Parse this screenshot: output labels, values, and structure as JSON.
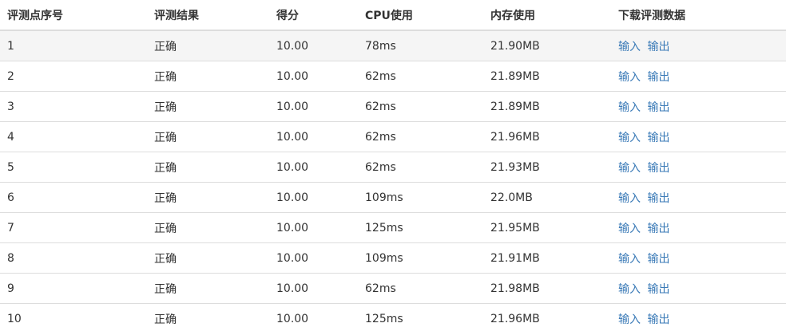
{
  "table": {
    "headers": [
      "评测点序号",
      "评测结果",
      "得分",
      "CPU使用",
      "内存使用",
      "下载评测数据"
    ],
    "rows": [
      {
        "index": "1",
        "result": "正确",
        "score": "10.00",
        "cpu": "78ms",
        "memory": "21.90MB",
        "input_label": "输入",
        "output_label": "输出"
      },
      {
        "index": "2",
        "result": "正确",
        "score": "10.00",
        "cpu": "62ms",
        "memory": "21.89MB",
        "input_label": "输入",
        "output_label": "输出"
      },
      {
        "index": "3",
        "result": "正确",
        "score": "10.00",
        "cpu": "62ms",
        "memory": "21.89MB",
        "input_label": "输入",
        "output_label": "输出"
      },
      {
        "index": "4",
        "result": "正确",
        "score": "10.00",
        "cpu": "62ms",
        "memory": "21.96MB",
        "input_label": "输入",
        "output_label": "输出"
      },
      {
        "index": "5",
        "result": "正确",
        "score": "10.00",
        "cpu": "62ms",
        "memory": "21.93MB",
        "input_label": "输入",
        "output_label": "输出"
      },
      {
        "index": "6",
        "result": "正确",
        "score": "10.00",
        "cpu": "109ms",
        "memory": "22.0MB",
        "input_label": "输入",
        "output_label": "输出"
      },
      {
        "index": "7",
        "result": "正确",
        "score": "10.00",
        "cpu": "125ms",
        "memory": "21.95MB",
        "input_label": "输入",
        "output_label": "输出"
      },
      {
        "index": "8",
        "result": "正确",
        "score": "10.00",
        "cpu": "109ms",
        "memory": "21.91MB",
        "input_label": "输入",
        "output_label": "输出"
      },
      {
        "index": "9",
        "result": "正确",
        "score": "10.00",
        "cpu": "62ms",
        "memory": "21.98MB",
        "input_label": "输入",
        "output_label": "输出"
      },
      {
        "index": "10",
        "result": "正确",
        "score": "10.00",
        "cpu": "125ms",
        "memory": "21.96MB",
        "input_label": "输入",
        "output_label": "输出"
      }
    ]
  },
  "colors": {
    "link": "#3a7ab7",
    "text": "#333333",
    "row_highlight": "#f5f5f5",
    "border": "#dddddd"
  }
}
